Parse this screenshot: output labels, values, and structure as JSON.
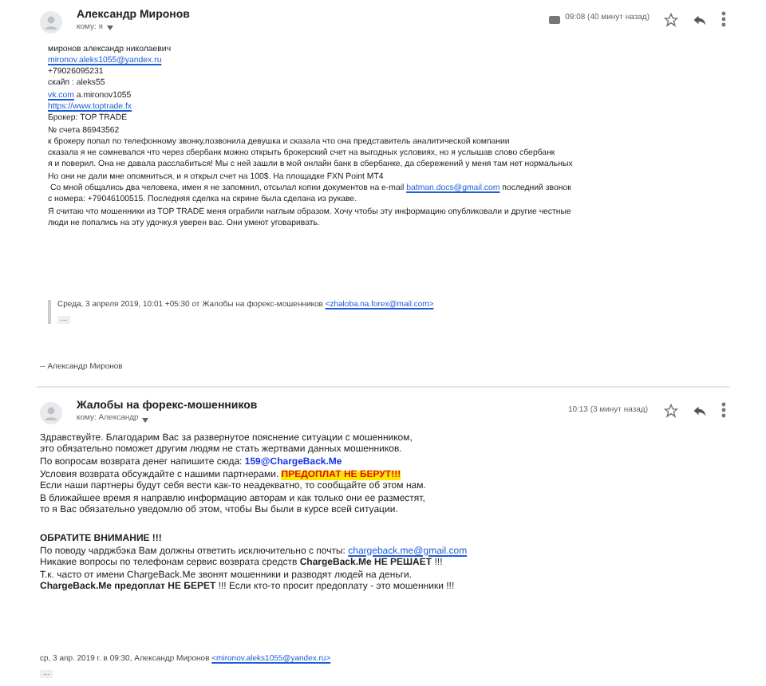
{
  "messages": [
    {
      "sender": "Александр Миронов",
      "recipient": "кому: я",
      "time": "09:08 (40 минут назад)",
      "has_label": true,
      "body": [
        [
          [
            {
              "kind": "text",
              "text": "миронов александр николаевич"
            }
          ],
          [
            {
              "kind": "link",
              "text": "mironov.aleks1055@yandex.ru"
            }
          ],
          [
            {
              "kind": "text",
              "text": "+79026095231"
            }
          ],
          [
            {
              "kind": "text",
              "text": "скайп : aleks55"
            }
          ],
          [
            {
              "kind": "link",
              "text": "vk.com"
            },
            {
              "kind": "text",
              "text": " a.mironov1055"
            }
          ],
          [
            {
              "kind": "link",
              "text": "https://www.toptrade.fx"
            }
          ],
          [
            {
              "kind": "text",
              "text": "Брокер: TOP TRADE"
            }
          ],
          [
            {
              "kind": "text",
              "text": "№ счета 86943562"
            }
          ],
          [
            {
              "kind": "text",
              "text": "к брокеру попал по телефонному звонку,позвонила девушка и сказала что она представитель аналитической компании"
            }
          ],
          [
            {
              "kind": "text",
              "text": "сказала я не сомневался что через сбербанк можно открыть брокерский счет на выгодных условиях, но я услышав слово сбербанк"
            }
          ],
          [
            {
              "kind": "text",
              "text": "я и поверил. Она не давала расслабиться! Мы с ней зашли в мой онлайн банк в сбербанке, да сбережений у меня там нет нормальных"
            }
          ],
          [
            {
              "kind": "text",
              "text": "Но они не дали мне опомниться, и я открыл счет на 100$. На площадке FXN Point MT4"
            }
          ],
          [
            {
              "kind": "text",
              "text": " Со мной общались два человека, имен я не запомнил, отсылал копии документов на e-mail "
            },
            {
              "kind": "link",
              "text": "batman.docs@gmail.com"
            },
            {
              "kind": "text",
              "text": " последний звонок"
            }
          ],
          [
            {
              "kind": "text",
              "text": "с номера: +79046100515. Последняя сделка на скрине была сделана из рукаве."
            }
          ],
          [
            {
              "kind": "text",
              "text": "Я считаю что мошенники из TOP TRADE меня ограбили наглым образом. Хочу чтобы эту информацию опубликовали и другие честные"
            }
          ],
          [
            {
              "kind": "text",
              "text": "люди не попались на эту удочку.я уверен вас. Они умеют уговаривать."
            }
          ]
        ]
      ],
      "quote": {
        "segments": [
          {
            "kind": "text",
            "text": "Среда, 3 апреля 2019, 10:01 +05:30 от Жалобы на форекс-мошенников "
          },
          {
            "kind": "link",
            "text": "<zhaloba.na.forex@mail.com>"
          }
        ],
        "more": "..."
      },
      "signature": "-- Александр Миронов"
    },
    {
      "sender": "Жалобы на форекс-мошенников",
      "recipient": "кому: Александр",
      "time": "10:13 (3 минут назад)",
      "has_label": false,
      "body": [
        [
          [
            {
              "kind": "text",
              "text": "Здравствуйте. Благодарим Вас за развернутое пояснение ситуации с мошенником,"
            }
          ],
          [
            {
              "kind": "text",
              "text": "это обязательно поможет другим людям не стать жертвами данных мошенников."
            }
          ],
          [
            {
              "kind": "text",
              "text": "По вопросам возврата денег напишите сюда: "
            },
            {
              "kind": "bold_link",
              "text": "159@ChargeBack.Me"
            }
          ],
          [
            {
              "kind": "text",
              "text": "Условия возврата обсуждайте с нашими партнерами. "
            },
            {
              "kind": "highlight",
              "text": "ПРЕДОПЛАТ НЕ БЕРУТ!!!"
            }
          ],
          [
            {
              "kind": "text",
              "text": "Если наши партнеры будут себя вести как-то неадекватно, то сообщайте об этом нам."
            }
          ],
          [
            {
              "kind": "text",
              "text": "В ближайшее время я направлю информацию авторам и как только они ее разместят,"
            }
          ],
          [
            {
              "kind": "text",
              "text": "то я Вас обязательно уведомлю об этом, чтобы Вы были в курсе всей ситуации."
            }
          ]
        ],
        [
          [
            {
              "kind": "bold",
              "text": "ОБРАТИТЕ ВНИМАНИЕ !!!"
            }
          ],
          [
            {
              "kind": "text",
              "text": "По поводу чарджбэка Вам должны ответить исключительно с почты: "
            },
            {
              "kind": "link",
              "text": "chargeback.me@gmail.com"
            }
          ],
          [
            {
              "kind": "text",
              "text": "Никакие вопросы по телефонам сервис возврата средств "
            },
            {
              "kind": "bold",
              "text": "ChargeBack.Me НЕ РЕШАЕТ"
            },
            {
              "kind": "text",
              "text": " !!!"
            }
          ],
          [
            {
              "kind": "text",
              "text": "Т.к. часто от имени ChargeBack.Me звонят мошенники и разводят людей на деньги."
            }
          ],
          [
            {
              "kind": "bold",
              "text": "ChargeBack.Me предоплат НЕ БЕРЕТ"
            },
            {
              "kind": "text",
              "text": " !!! Если кто-то просит предоплату - это мошенники !!!"
            }
          ]
        ]
      ],
      "quote": {
        "segments": [
          {
            "kind": "text",
            "text": "ср, 3 апр. 2019 г. в 09:30, Александр Миронов "
          },
          {
            "kind": "link",
            "text": "<mironov.aleks1055@yandex.ru>"
          }
        ],
        "more": "..."
      }
    }
  ]
}
